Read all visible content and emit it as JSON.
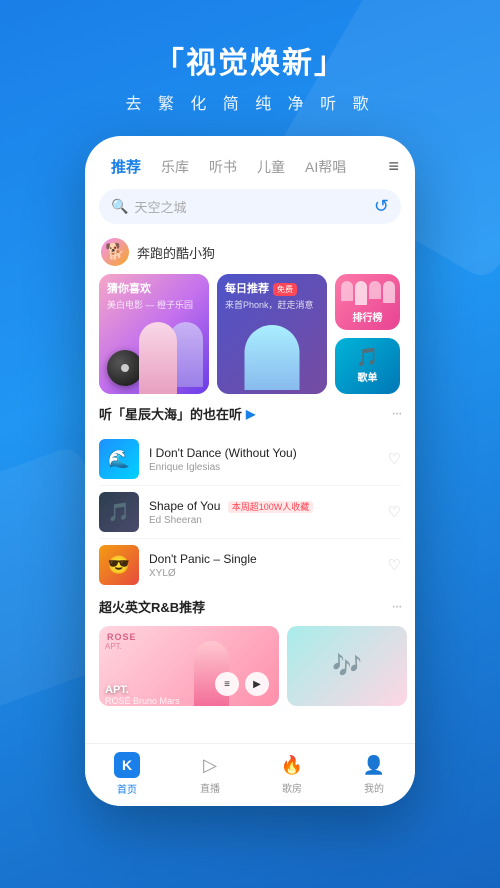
{
  "hero": {
    "title": "「视觉焕新」",
    "subtitle": "去 繁 化 简   纯 净 听 歌"
  },
  "nav": {
    "tabs": [
      {
        "label": "推荐",
        "active": true
      },
      {
        "label": "乐库",
        "active": false
      },
      {
        "label": "听书",
        "active": false
      },
      {
        "label": "儿童",
        "active": false
      },
      {
        "label": "AI帮唱",
        "active": false
      }
    ],
    "menu_icon": "≡"
  },
  "search": {
    "placeholder": "天空之城",
    "extra_icon": "↺"
  },
  "user": {
    "name": "奔跑的酷小狗",
    "avatar_text": "🐕"
  },
  "cards": {
    "main": {
      "label": "猜你喜欢",
      "sub": "美白电影 — 橙子乐园"
    },
    "daily": {
      "label": "每日推荐",
      "badge": "免费",
      "sub": "来首Phonk，赶走消意"
    },
    "chart": {
      "label": "排行榜"
    },
    "playlist": {
      "label": "歌单"
    }
  },
  "section1": {
    "title": "听「星辰大海」的也在听",
    "play_icon": "▶"
  },
  "songs": [
    {
      "name": "I Don't Dance (Without You)",
      "artist": "Enrique Iglesias",
      "thumb_class": "thumb-1"
    },
    {
      "name": "Shape of You",
      "artist": "Ed Sheeran",
      "badge": "本周超100W人收藏",
      "thumb_class": "thumb-2"
    },
    {
      "name": "Don't Panic – Single",
      "artist": "XYLØ",
      "thumb_class": "thumb-3"
    }
  ],
  "section2": {
    "title": "超火英文R&B推荐"
  },
  "playlist_strip": {
    "title": "APT.",
    "artists": "ROSÉ Bruno Mars"
  },
  "bottom_nav": [
    {
      "label": "首页",
      "icon": "K",
      "active": true
    },
    {
      "label": "直播",
      "icon": "▷",
      "active": false
    },
    {
      "label": "歌房",
      "icon": "🔥",
      "active": false
    },
    {
      "label": "我的",
      "icon": "👤",
      "active": false
    }
  ]
}
